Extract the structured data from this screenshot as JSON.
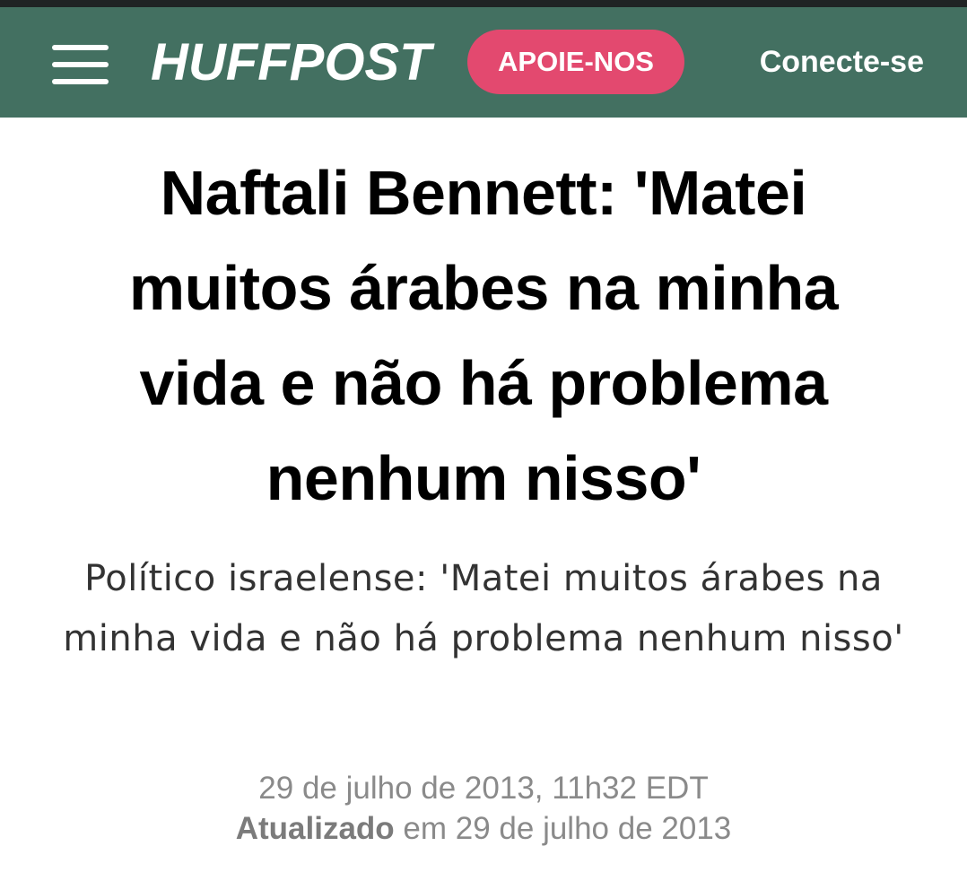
{
  "header": {
    "logo_text": "HUFFPOST",
    "support_label": "APOIE-NOS",
    "login_label": "Conecte-se",
    "menu_icon": "hamburger-menu-icon",
    "background_color": "#437061",
    "support_color": "#e3496f"
  },
  "article": {
    "headline": "Naftali Bennett: 'Matei muitos árabes na minha vida e não há problema nenhum nisso'",
    "subtitle": "Político israelense: 'Matei muitos árabes na minha vida e não há problema nenhum nisso'",
    "published": "29 de julho de 2013, 11h32 EDT",
    "updated_label": "Atualizado",
    "updated_text": " em 29 de julho de 2013"
  }
}
